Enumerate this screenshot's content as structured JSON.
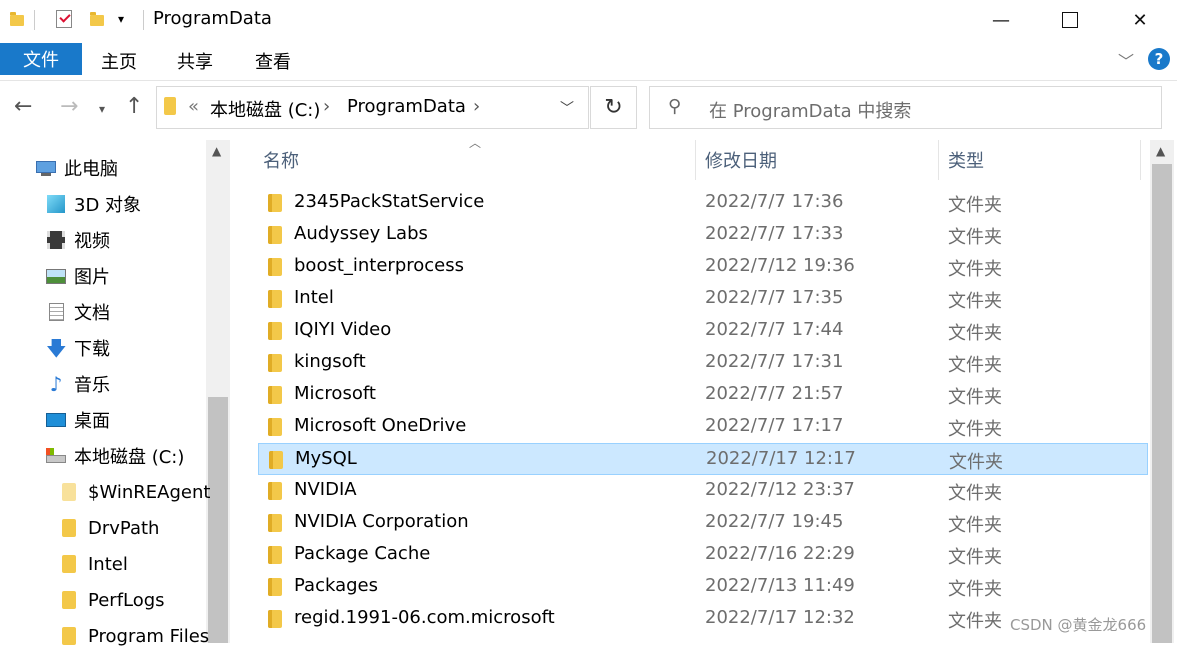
{
  "window": {
    "title": "ProgramData",
    "minimize_glyph": "—",
    "maximize_glyph": "☐",
    "close_glyph": "✕"
  },
  "ribbon": {
    "tabs": [
      "文件",
      "主页",
      "共享",
      "查看"
    ],
    "help": "?"
  },
  "address": {
    "chevron": "«",
    "segments": [
      "本地磁盘 (C:)",
      "ProgramData"
    ],
    "sep": "›"
  },
  "search": {
    "placeholder": "在 ProgramData 中搜索"
  },
  "nav": {
    "items": [
      {
        "label": "此电脑",
        "icon": "computer-icon"
      },
      {
        "label": "3D 对象",
        "icon": "3d-objects-icon"
      },
      {
        "label": "视频",
        "icon": "video-icon"
      },
      {
        "label": "图片",
        "icon": "pictures-icon"
      },
      {
        "label": "文档",
        "icon": "documents-icon"
      },
      {
        "label": "下载",
        "icon": "download-icon"
      },
      {
        "label": "音乐",
        "icon": "music-icon"
      },
      {
        "label": "桌面",
        "icon": "desktop-icon"
      },
      {
        "label": "本地磁盘 (C:)",
        "icon": "drive-icon"
      },
      {
        "label": "$WinREAgent",
        "icon": "folder-icon"
      },
      {
        "label": "DrvPath",
        "icon": "folder-icon"
      },
      {
        "label": "Intel",
        "icon": "folder-icon"
      },
      {
        "label": "PerfLogs",
        "icon": "folder-icon"
      },
      {
        "label": "Program Files",
        "icon": "folder-icon"
      }
    ]
  },
  "columns": {
    "name": "名称",
    "date": "修改日期",
    "type": "类型"
  },
  "files": [
    {
      "name": "2345PackStatService",
      "date": "2022/7/7 17:36",
      "type": "文件夹"
    },
    {
      "name": "Audyssey Labs",
      "date": "2022/7/7 17:33",
      "type": "文件夹"
    },
    {
      "name": "boost_interprocess",
      "date": "2022/7/12 19:36",
      "type": "文件夹"
    },
    {
      "name": "Intel",
      "date": "2022/7/7 17:35",
      "type": "文件夹"
    },
    {
      "name": "IQIYI Video",
      "date": "2022/7/7 17:44",
      "type": "文件夹"
    },
    {
      "name": "kingsoft",
      "date": "2022/7/7 17:31",
      "type": "文件夹"
    },
    {
      "name": "Microsoft",
      "date": "2022/7/7 21:57",
      "type": "文件夹"
    },
    {
      "name": "Microsoft OneDrive",
      "date": "2022/7/7 17:17",
      "type": "文件夹"
    },
    {
      "name": "MySQL",
      "date": "2022/7/17 12:17",
      "type": "文件夹",
      "selected": true
    },
    {
      "name": "NVIDIA",
      "date": "2022/7/12 23:37",
      "type": "文件夹"
    },
    {
      "name": "NVIDIA Corporation",
      "date": "2022/7/7 19:45",
      "type": "文件夹"
    },
    {
      "name": "Package Cache",
      "date": "2022/7/16 22:29",
      "type": "文件夹"
    },
    {
      "name": "Packages",
      "date": "2022/7/13 11:49",
      "type": "文件夹"
    },
    {
      "name": "regid.1991-06.com.microsoft",
      "date": "2022/7/17 12:32",
      "type": "文件夹"
    }
  ],
  "watermark": "CSDN @黄金龙666",
  "colors": {
    "accent": "#1979ca",
    "selection": "#cce8ff",
    "selection_border": "#99d1ff",
    "folder": "#f3c849"
  }
}
